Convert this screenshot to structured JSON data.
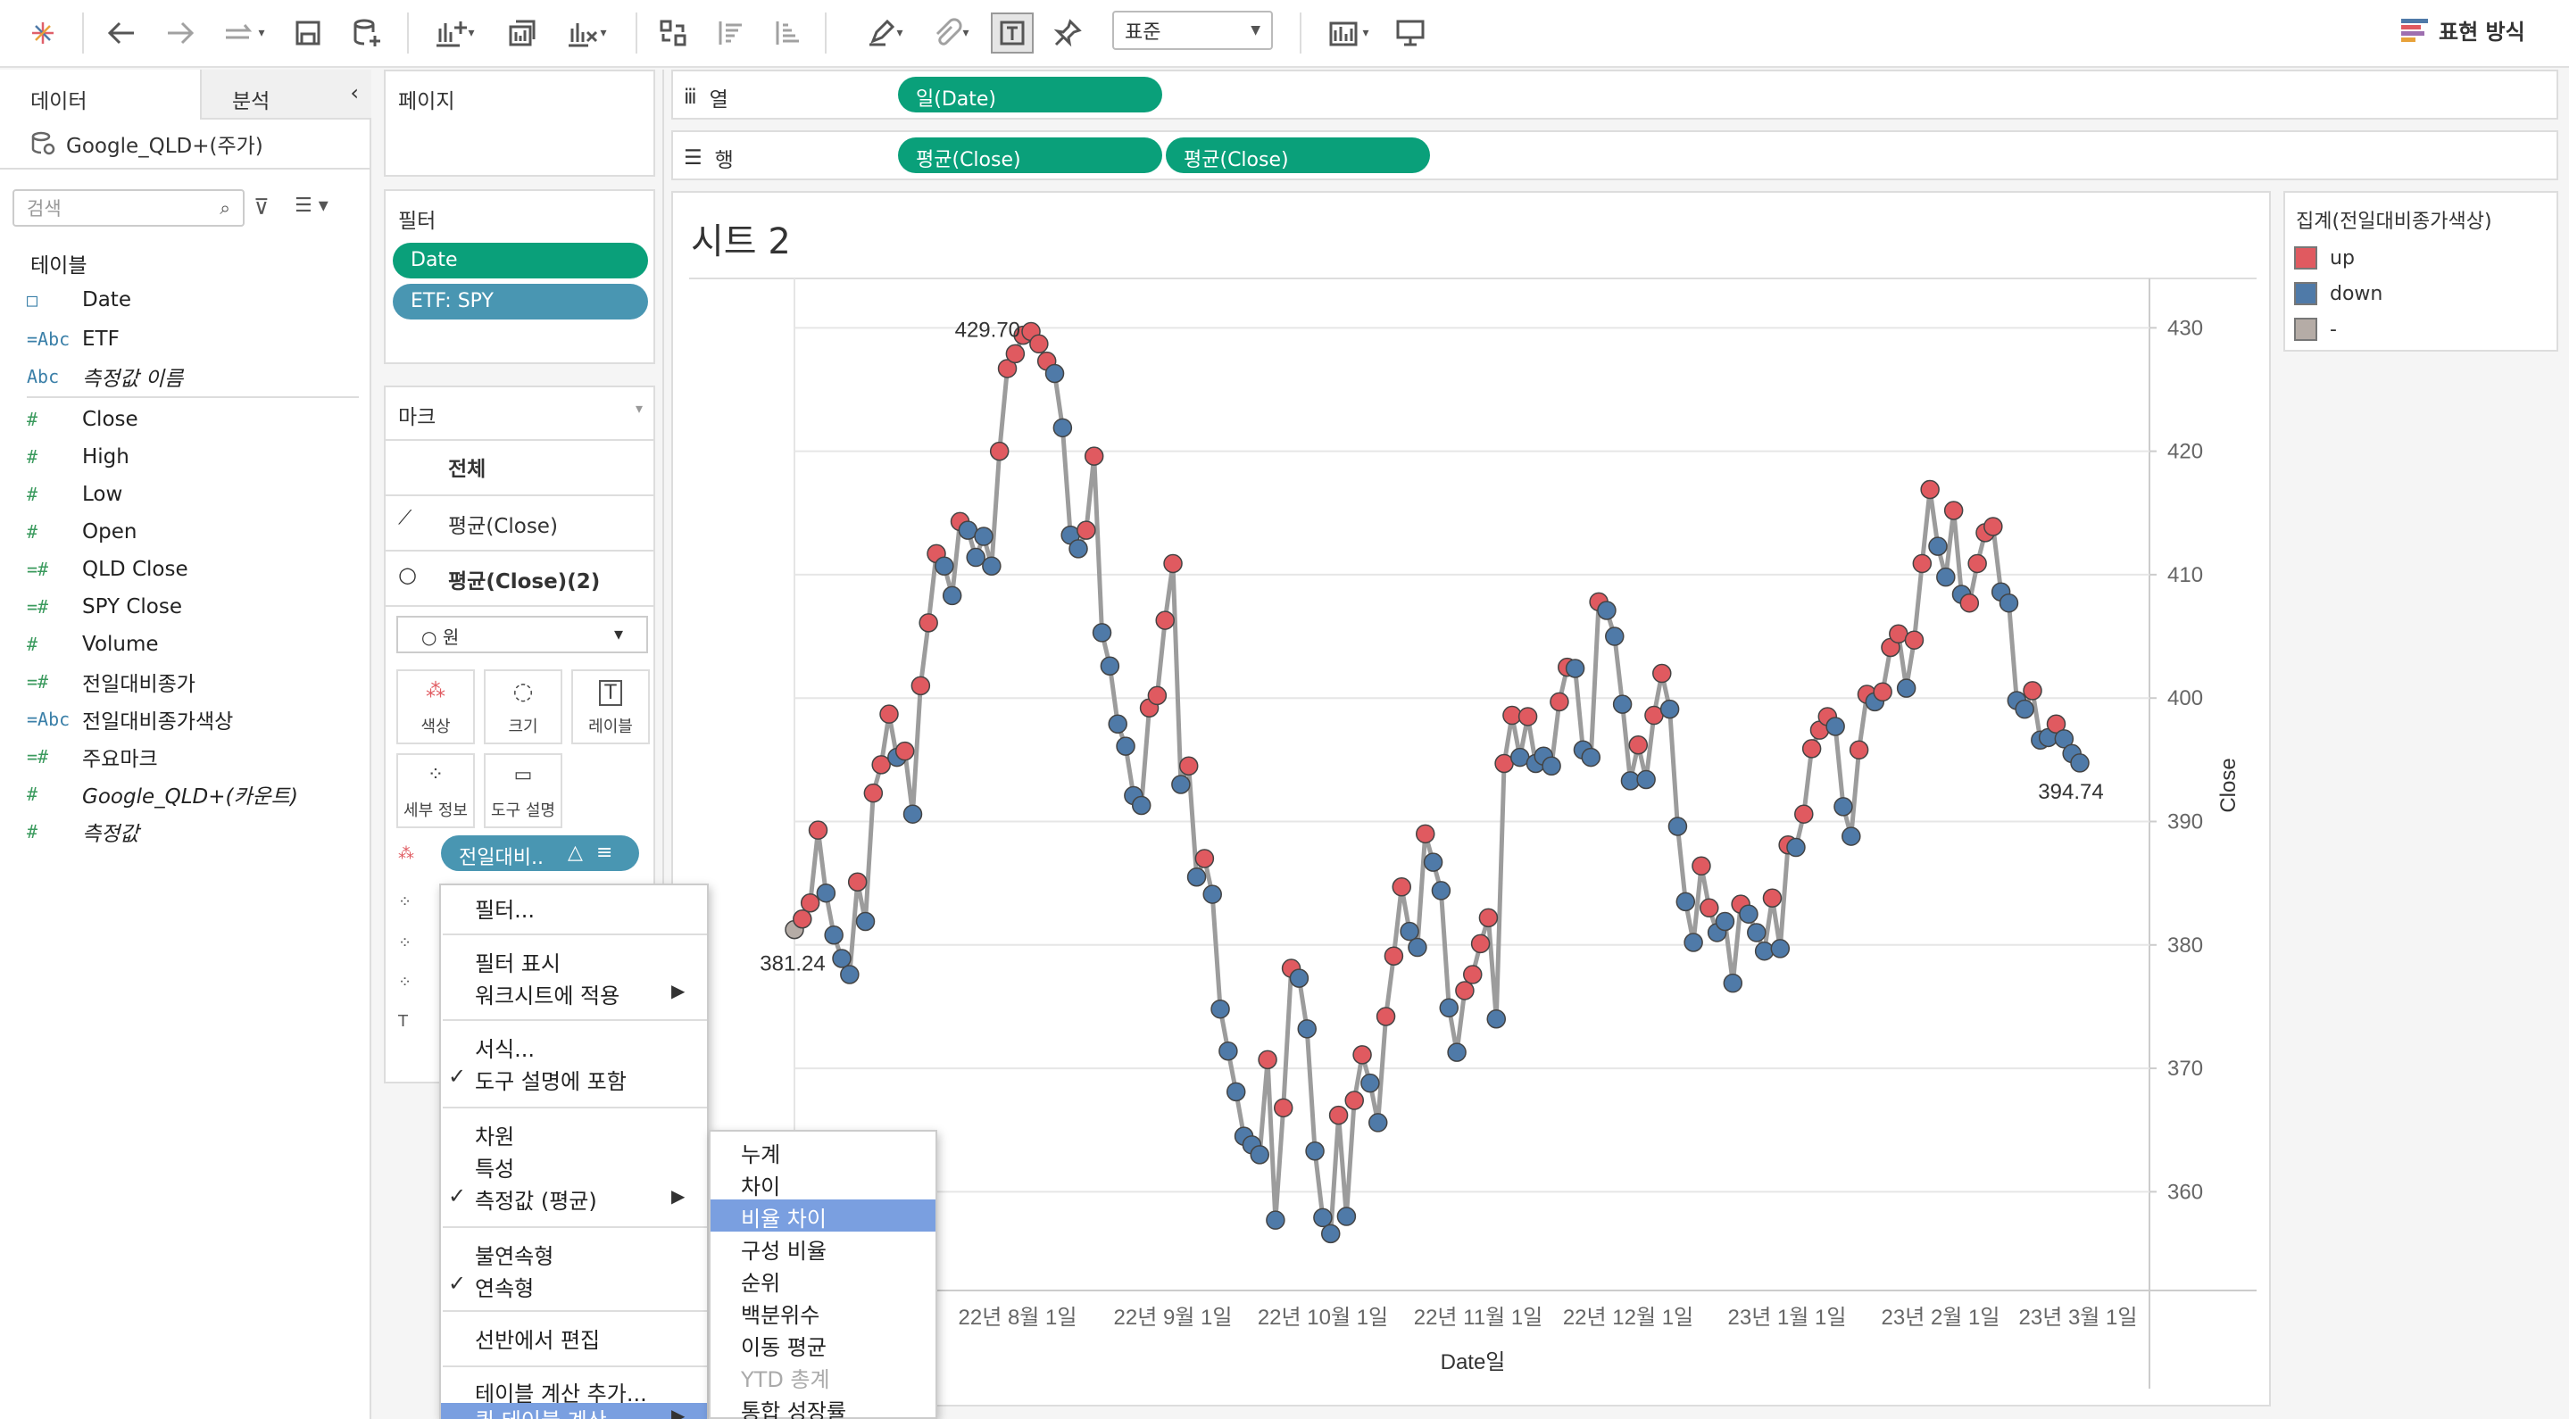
{
  "toolbar": {
    "format_select": "표준",
    "show_me": "표현 방식",
    "icons": [
      "tableau-logo-icon",
      "undo-icon",
      "redo-icon",
      "forward-icon",
      "save-icon",
      "new-datasource-icon",
      "new-worksheet-icon",
      "duplicate-icon",
      "clear-icon",
      "swap-icon",
      "sort-asc-icon",
      "sort-desc-icon",
      "highlight-icon",
      "attach-icon",
      "labels-icon",
      "pin-icon",
      "fit-icon",
      "presentation-icon"
    ]
  },
  "datapane": {
    "tab_data": "데이터",
    "tab_analysis": "분석",
    "datasource": "Google_QLD+(주가)",
    "search_placeholder": "검색",
    "tables_header": "테이블",
    "fields": [
      {
        "icon": "□",
        "name": "Date"
      },
      {
        "icon": "=Abc",
        "name": "ETF"
      },
      {
        "icon": "Abc",
        "name": "측정값 이름"
      },
      {
        "icon": "#",
        "name": "Close"
      },
      {
        "icon": "#",
        "name": "High"
      },
      {
        "icon": "#",
        "name": "Low"
      },
      {
        "icon": "#",
        "name": "Open"
      },
      {
        "icon": "=#",
        "name": "QLD Close"
      },
      {
        "icon": "=#",
        "name": "SPY Close"
      },
      {
        "icon": "#",
        "name": "Volume"
      },
      {
        "icon": "=#",
        "name": "전일대비종가"
      },
      {
        "icon": "=Abc",
        "name": "전일대비종가색상"
      },
      {
        "icon": "=#",
        "name": "주요마크"
      },
      {
        "icon": "#",
        "name": "Google_QLD+(카운트)"
      },
      {
        "icon": "#",
        "name": "측정값"
      }
    ]
  },
  "pages": {
    "title": "페이지"
  },
  "filters": {
    "title": "필터",
    "items": [
      "Date",
      "ETF: SPY"
    ]
  },
  "marks": {
    "title": "마크",
    "all": "전체",
    "layer1": "평균(Close)",
    "layer2": "평균(Close)(2)",
    "mark_type": "원",
    "buttons": [
      "색상",
      "크기",
      "레이블",
      "세부 정보",
      "도구 설명"
    ],
    "color_pill": "전일대비..",
    "color_pill_delta": "△"
  },
  "shelves": {
    "columns_label": "열",
    "rows_label": "행",
    "columns_pill": "일(Date)",
    "rows_pills": [
      "평균(Close)",
      "평균(Close)"
    ]
  },
  "sheet": {
    "title": "시트 2"
  },
  "legend": {
    "title": "집계(전일대비종가색상)",
    "items": [
      {
        "label": "up",
        "color": "#e05a60"
      },
      {
        "label": "down",
        "color": "#4f7aa8"
      },
      {
        "label": "-",
        "color": "#b5aca6"
      }
    ]
  },
  "context_menu": {
    "items": [
      {
        "label": "필터...",
        "check": "",
        "arrow": ""
      },
      {
        "label": "필터 표시",
        "check": "",
        "arrow": ""
      },
      {
        "label": "워크시트에 적용",
        "check": "",
        "arrow": "▶"
      },
      {
        "label": "서식...",
        "check": "",
        "arrow": ""
      },
      {
        "label": "도구 설명에 포함",
        "check": "✓",
        "arrow": ""
      },
      {
        "label": "차원",
        "check": "",
        "arrow": ""
      },
      {
        "label": "특성",
        "check": "",
        "arrow": ""
      },
      {
        "label": "측정값 (평균)",
        "check": "✓",
        "arrow": "▶"
      },
      {
        "label": "불연속형",
        "check": "",
        "arrow": ""
      },
      {
        "label": "연속형",
        "check": "✓",
        "arrow": ""
      },
      {
        "label": "선반에서 편집",
        "check": "",
        "arrow": ""
      },
      {
        "label": "테이블 계산 추가...",
        "check": "",
        "arrow": ""
      },
      {
        "label": "퀵 테이블 계산",
        "check": "",
        "arrow": "▶"
      }
    ],
    "submenu": [
      "누계",
      "차이",
      "비율 차이",
      "구성 비율",
      "순위",
      "백분위수",
      "이동 평균",
      "YTD 총계",
      "통합 성장률"
    ],
    "submenu_highlight": 2,
    "submenu_disabled": 7
  },
  "chart_data": {
    "type": "line",
    "xlabel": "Date일",
    "ylabel": "Close",
    "x_ticks": [
      "22년 8월 1일",
      "22년 9월 1일",
      "22년 10월 1일",
      "22년 11월 1일",
      "22년 12월 1일",
      "23년 1월 1일",
      "23년 2월 1일",
      "23년 3월 1일"
    ],
    "y_ticks": [
      360,
      370,
      380,
      390,
      400,
      410,
      420,
      430
    ],
    "ylim": [
      352,
      434
    ],
    "axis_position": "right",
    "annotations": [
      {
        "text": "429.70",
        "index": 40
      },
      {
        "text": "381.24",
        "index": 0
      },
      {
        "text": "394.74",
        "index": 175
      }
    ],
    "color_key": {
      "up": "#e05a60",
      "down": "#4f7aa8",
      "-": "#b5aca6"
    },
    "points": [
      [
        381.24,
        "-"
      ],
      [
        382.1,
        "up"
      ],
      [
        383.4,
        "up"
      ],
      [
        389.3,
        "up"
      ],
      [
        384.2,
        "down"
      ],
      [
        380.8,
        "down"
      ],
      [
        378.9,
        "down"
      ],
      [
        377.6,
        "down"
      ],
      [
        385.1,
        "up"
      ],
      [
        381.9,
        "down"
      ],
      [
        392.3,
        "up"
      ],
      [
        394.6,
        "up"
      ],
      [
        398.7,
        "up"
      ],
      [
        395.2,
        "down"
      ],
      [
        395.7,
        "up"
      ],
      [
        390.6,
        "down"
      ],
      [
        401.0,
        "up"
      ],
      [
        406.1,
        "up"
      ],
      [
        411.7,
        "up"
      ],
      [
        410.7,
        "down"
      ],
      [
        408.3,
        "down"
      ],
      [
        414.3,
        "up"
      ],
      [
        413.6,
        "down"
      ],
      [
        411.4,
        "down"
      ],
      [
        413.1,
        "down"
      ],
      [
        410.7,
        "down"
      ],
      [
        420.0,
        "up"
      ],
      [
        426.7,
        "up"
      ],
      [
        427.9,
        "up"
      ],
      [
        429.4,
        "up"
      ],
      [
        429.7,
        "up"
      ],
      [
        428.7,
        "up"
      ],
      [
        427.3,
        "up"
      ],
      [
        426.3,
        "down"
      ],
      [
        421.9,
        "down"
      ],
      [
        413.2,
        "down"
      ],
      [
        412.1,
        "down"
      ],
      [
        413.6,
        "up"
      ],
      [
        419.6,
        "up"
      ],
      [
        405.3,
        "down"
      ],
      [
        402.6,
        "down"
      ],
      [
        397.9,
        "down"
      ],
      [
        396.1,
        "down"
      ],
      [
        392.1,
        "down"
      ],
      [
        391.3,
        "down"
      ],
      [
        399.2,
        "up"
      ],
      [
        400.2,
        "up"
      ],
      [
        406.3,
        "up"
      ],
      [
        410.9,
        "up"
      ],
      [
        393.0,
        "down"
      ],
      [
        394.5,
        "up"
      ],
      [
        385.5,
        "down"
      ],
      [
        387.0,
        "up"
      ],
      [
        384.1,
        "down"
      ],
      [
        374.8,
        "down"
      ],
      [
        371.4,
        "down"
      ],
      [
        368.1,
        "down"
      ],
      [
        364.5,
        "down"
      ],
      [
        363.8,
        "down"
      ],
      [
        363.0,
        "down"
      ],
      [
        370.7,
        "up"
      ],
      [
        357.7,
        "down"
      ],
      [
        366.8,
        "up"
      ],
      [
        378.1,
        "up"
      ],
      [
        377.3,
        "down"
      ],
      [
        373.2,
        "down"
      ],
      [
        363.3,
        "down"
      ],
      [
        357.9,
        "down"
      ],
      [
        356.6,
        "down"
      ],
      [
        366.2,
        "up"
      ],
      [
        358.0,
        "down"
      ],
      [
        367.4,
        "up"
      ],
      [
        371.1,
        "up"
      ],
      [
        368.8,
        "down"
      ],
      [
        365.6,
        "down"
      ],
      [
        374.2,
        "up"
      ],
      [
        379.1,
        "up"
      ],
      [
        384.7,
        "up"
      ],
      [
        381.1,
        "down"
      ],
      [
        379.8,
        "down"
      ],
      [
        389.0,
        "up"
      ],
      [
        386.7,
        "down"
      ],
      [
        384.4,
        "down"
      ],
      [
        374.9,
        "down"
      ],
      [
        371.3,
        "down"
      ],
      [
        376.3,
        "up"
      ],
      [
        377.6,
        "up"
      ],
      [
        380.1,
        "up"
      ],
      [
        382.2,
        "up"
      ],
      [
        374.0,
        "down"
      ],
      [
        394.7,
        "up"
      ],
      [
        398.6,
        "up"
      ],
      [
        395.2,
        "down"
      ],
      [
        398.5,
        "up"
      ],
      [
        394.7,
        "down"
      ],
      [
        395.3,
        "down"
      ],
      [
        394.5,
        "down"
      ],
      [
        399.7,
        "up"
      ],
      [
        402.5,
        "up"
      ],
      [
        402.4,
        "down"
      ],
      [
        395.8,
        "down"
      ],
      [
        395.2,
        "down"
      ],
      [
        407.8,
        "up"
      ],
      [
        407.1,
        "down"
      ],
      [
        405.0,
        "down"
      ],
      [
        399.5,
        "down"
      ],
      [
        393.3,
        "down"
      ],
      [
        396.2,
        "up"
      ],
      [
        393.4,
        "down"
      ],
      [
        398.6,
        "up"
      ],
      [
        402.0,
        "up"
      ],
      [
        399.1,
        "down"
      ],
      [
        389.6,
        "down"
      ],
      [
        383.5,
        "down"
      ],
      [
        380.2,
        "down"
      ],
      [
        386.4,
        "up"
      ],
      [
        383.0,
        "up"
      ],
      [
        381.0,
        "down"
      ],
      [
        381.9,
        "down"
      ],
      [
        376.9,
        "down"
      ],
      [
        383.3,
        "up"
      ],
      [
        382.5,
        "down"
      ],
      [
        381.0,
        "down"
      ],
      [
        379.5,
        "down"
      ],
      [
        383.8,
        "up"
      ],
      [
        379.7,
        "down"
      ],
      [
        388.1,
        "up"
      ],
      [
        387.9,
        "down"
      ],
      [
        390.6,
        "up"
      ],
      [
        395.9,
        "up"
      ],
      [
        397.4,
        "up"
      ],
      [
        398.5,
        "up"
      ],
      [
        397.7,
        "down"
      ],
      [
        391.2,
        "down"
      ],
      [
        388.8,
        "down"
      ],
      [
        395.8,
        "up"
      ],
      [
        400.3,
        "up"
      ],
      [
        399.7,
        "down"
      ],
      [
        400.5,
        "up"
      ],
      [
        404.1,
        "up"
      ],
      [
        405.2,
        "up"
      ],
      [
        400.8,
        "down"
      ],
      [
        404.7,
        "up"
      ],
      [
        410.9,
        "up"
      ],
      [
        416.9,
        "up"
      ],
      [
        412.3,
        "down"
      ],
      [
        409.8,
        "down"
      ],
      [
        415.2,
        "up"
      ],
      [
        408.4,
        "down"
      ],
      [
        407.7,
        "up"
      ],
      [
        410.9,
        "up"
      ],
      [
        413.4,
        "up"
      ],
      [
        413.9,
        "up"
      ],
      [
        408.6,
        "down"
      ],
      [
        407.7,
        "down"
      ],
      [
        399.8,
        "down"
      ],
      [
        399.1,
        "down"
      ],
      [
        400.6,
        "up"
      ],
      [
        396.6,
        "down"
      ],
      [
        396.8,
        "down"
      ],
      [
        397.9,
        "up"
      ],
      [
        396.7,
        "down"
      ],
      [
        395.5,
        "down"
      ],
      [
        394.74,
        "down"
      ]
    ]
  }
}
